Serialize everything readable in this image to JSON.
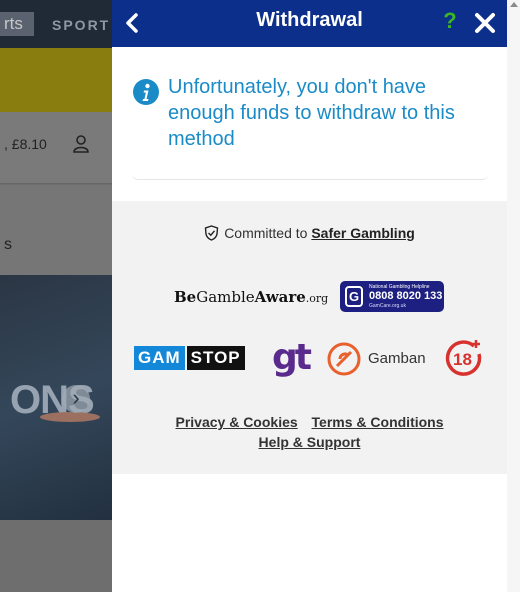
{
  "background_page": {
    "logo_text": "rts",
    "nav_sport": "SPORT",
    "balance": ", £8.10",
    "section_letter": "s",
    "banner_text": "ONS"
  },
  "panel": {
    "title": "Withdrawal",
    "help_label": "?",
    "message": "Unfortunately, you don't have enough funds to withdraw to this method",
    "colors": {
      "header": "#0b2f8a",
      "message": "#1b8bc7",
      "help": "#3cb527"
    }
  },
  "footer": {
    "committed_text": "Committed to",
    "safer_link": "Safer Gambling",
    "begamble": {
      "be": "Be",
      "gamble": "Gamble",
      "aware": "Aware",
      "org": ".org"
    },
    "helpline": {
      "top": "National Gambling Helpline",
      "number": "0808 8020 133",
      "site": "GamCare.org.uk"
    },
    "gamstop": {
      "gam": "GAM",
      "stop": "STOP"
    },
    "gt": "gt",
    "gamban": "Gamban",
    "links": {
      "privacy": "Privacy & Cookies",
      "terms": "Terms & Conditions",
      "help": "Help & Support"
    }
  }
}
